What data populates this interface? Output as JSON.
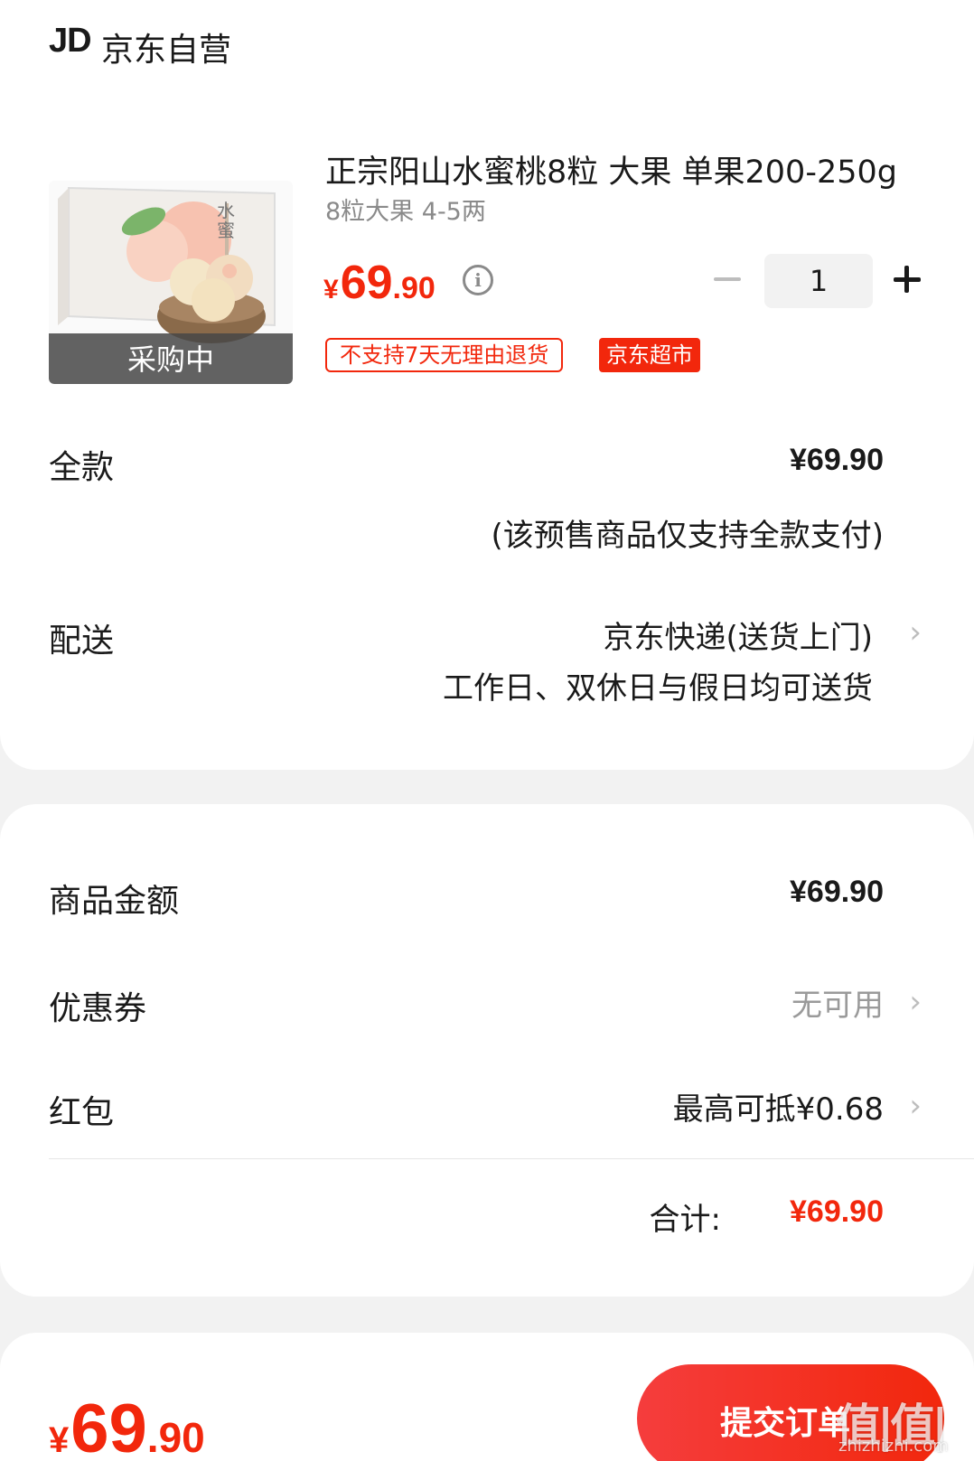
{
  "shop": {
    "logo": "JD",
    "name": "京东自营"
  },
  "product": {
    "title": "正宗阳山水蜜桃8粒 大果 单果200-250g",
    "spec": "8粒大果 4-5两",
    "image_status": "采购中",
    "price_currency": "¥",
    "price_integer": "69",
    "price_decimal": ".90",
    "quantity": "1",
    "tags": {
      "return_policy": "不支持7天无理由退货",
      "channel": "京东超市"
    }
  },
  "payment": {
    "label": "全款",
    "value": "¥69.90",
    "note": "(该预售商品仅支持全款支付)"
  },
  "delivery": {
    "label": "配送",
    "method": "京东快递(送货上门)",
    "time": "工作日、双休日与假日均可送货"
  },
  "summary": {
    "amount_label": "商品金额",
    "amount_value": "¥69.90",
    "coupon_label": "优惠券",
    "coupon_value": "无可用",
    "redpack_label": "红包",
    "redpack_value": "最高可抵¥0.68",
    "total_label": "合计:",
    "total_value": "¥69.90"
  },
  "footer": {
    "price_currency": "¥",
    "price_integer": "69",
    "price_decimal": ".90",
    "submit_label": "提交订单"
  },
  "watermark": {
    "main": "值|值|值",
    "sub": "zhizhizhi.com"
  },
  "colors": {
    "accent": "#f2270c",
    "background": "#f2f2f2"
  },
  "icons": {
    "info": "info-icon",
    "chevron": "chevron-right-icon",
    "minus": "minus-icon",
    "plus": "plus-icon"
  }
}
